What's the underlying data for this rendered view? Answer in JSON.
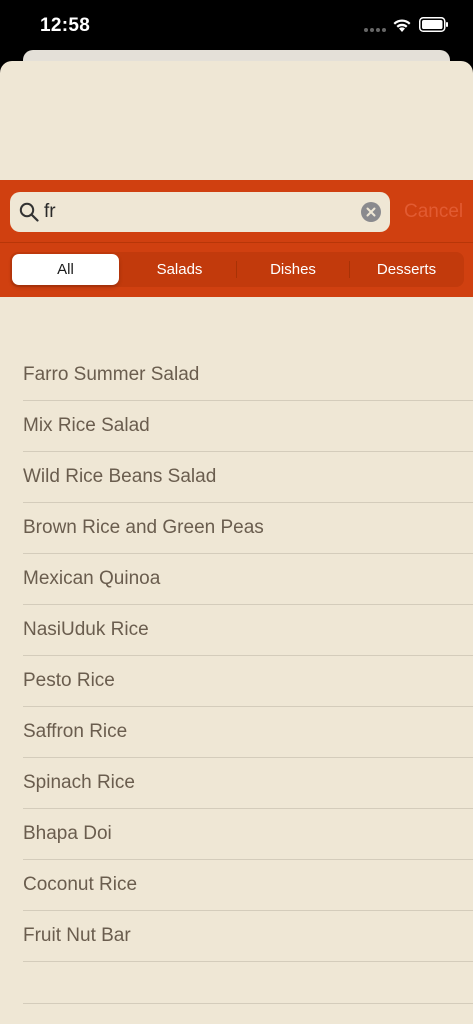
{
  "status_bar": {
    "time": "12:58"
  },
  "search": {
    "query": "fr",
    "cancel_label": "Cancel"
  },
  "scope": {
    "segments": [
      "All",
      "Salads",
      "Dishes",
      "Desserts"
    ],
    "selected": "All"
  },
  "results": [
    "Farro Summer Salad",
    "Mix Rice Salad",
    "Wild Rice Beans Salad",
    "Brown Rice and Green Peas",
    "Mexican Quinoa",
    "NasiUduk Rice",
    "Pesto Rice",
    "Saffron Rice",
    "Spinach Rice",
    "Bhapa Doi",
    "Coconut Rice",
    "Fruit Nut Bar"
  ],
  "colors": {
    "accent": "#d04010",
    "background": "#efe7d5",
    "text": "#6a5d4e"
  }
}
